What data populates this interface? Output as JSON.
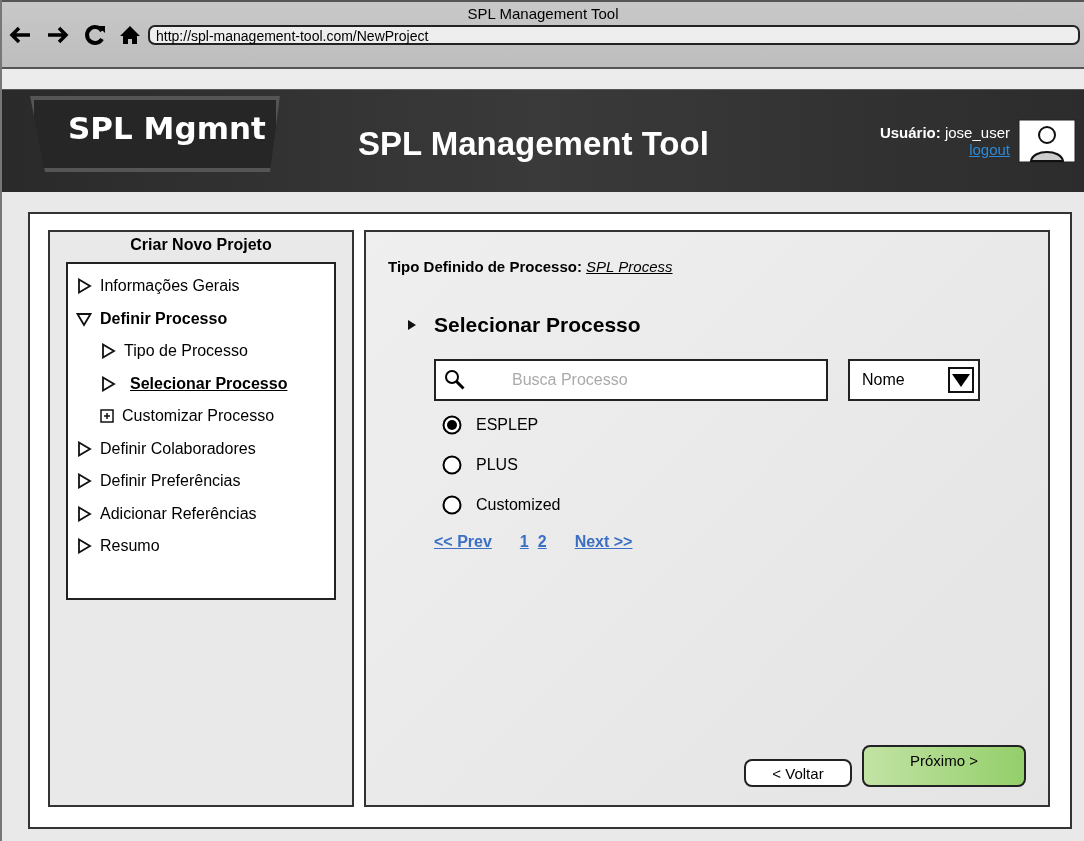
{
  "window": {
    "title": "SPL Management Tool",
    "url": "http://spl-management-tool.com/NewProject"
  },
  "header": {
    "logo": "SPL Mgmnt",
    "title": "SPL Management Tool",
    "user_label": "Usuário:",
    "user": "jose_user",
    "logout": "logout"
  },
  "sidebar": {
    "title": "Criar Novo Projeto",
    "items": [
      {
        "label": "Informações Gerais",
        "kind": "arrow",
        "expanded": false,
        "selected": false
      },
      {
        "label": "Definir Processo",
        "kind": "arrow",
        "expanded": true,
        "selected": false,
        "children": [
          {
            "label": "Tipo de Processo",
            "kind": "arrow",
            "expanded": false,
            "selected": false
          },
          {
            "label": "Selecionar Processo",
            "kind": "arrow",
            "expanded": false,
            "selected": true
          },
          {
            "label": "Customizar Processo",
            "kind": "plus",
            "expanded": false,
            "selected": false
          }
        ]
      },
      {
        "label": "Definir Colaboradores",
        "kind": "arrow",
        "expanded": false,
        "selected": false
      },
      {
        "label": "Definir Preferências",
        "kind": "arrow",
        "expanded": false,
        "selected": false
      },
      {
        "label": "Adicionar Referências",
        "kind": "arrow",
        "expanded": false,
        "selected": false
      },
      {
        "label": "Resumo",
        "kind": "arrow",
        "expanded": false,
        "selected": false
      }
    ]
  },
  "main": {
    "type_label": "Tipo Definido de Processo:",
    "type_value": "SPL Process",
    "section_title": "Selecionar Processo",
    "search": {
      "placeholder": "Busca Processo"
    },
    "sort": {
      "value": "Nome"
    },
    "options": [
      {
        "label": "ESPLEP",
        "selected": true
      },
      {
        "label": "PLUS",
        "selected": false
      },
      {
        "label": "Customized",
        "selected": false
      }
    ],
    "pagination": {
      "prev": "<< Prev",
      "pages": [
        "1",
        "2"
      ],
      "next": "Next >>"
    },
    "buttons": {
      "back": "< Voltar",
      "next": "Próximo >"
    }
  }
}
